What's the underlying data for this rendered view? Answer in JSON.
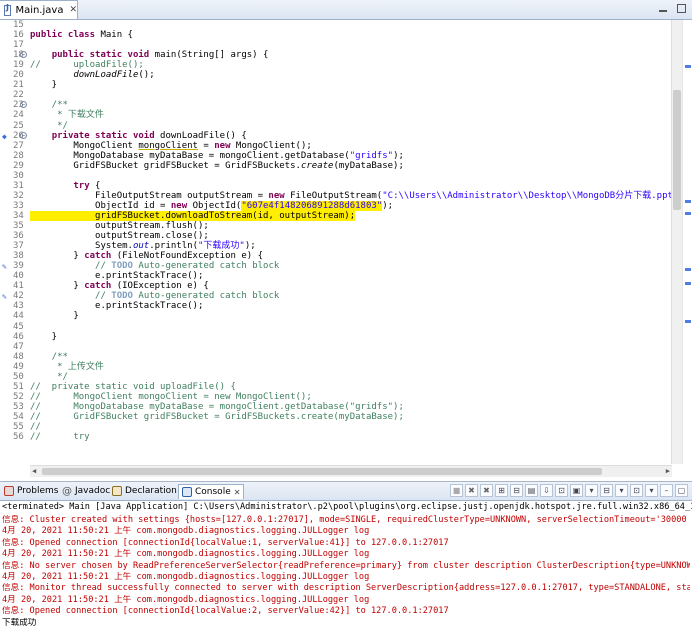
{
  "editor": {
    "tab_title": "Main.java",
    "tab_close": "✕"
  },
  "code_lines": [
    {
      "num": "15",
      "fold": "",
      "marker": "",
      "segs": [
        {
          "t": "",
          "c": ""
        }
      ]
    },
    {
      "num": "16",
      "fold": "",
      "marker": "",
      "segs": [
        {
          "t": "public class",
          "c": "kw"
        },
        {
          "t": " Main {",
          "c": ""
        }
      ]
    },
    {
      "num": "17",
      "fold": "",
      "marker": "",
      "segs": [
        {
          "t": "",
          "c": ""
        }
      ]
    },
    {
      "num": "18",
      "fold": "⊖",
      "marker": "",
      "segs": [
        {
          "t": "    ",
          "c": ""
        },
        {
          "t": "public static void",
          "c": "kw"
        },
        {
          "t": " main(String[] args) {",
          "c": ""
        }
      ]
    },
    {
      "num": "19",
      "fold": "",
      "marker": "",
      "segs": [
        {
          "t": "//      uploadFile();",
          "c": "cm"
        }
      ]
    },
    {
      "num": "20",
      "fold": "",
      "marker": "",
      "segs": [
        {
          "t": "        ",
          "c": ""
        },
        {
          "t": "downLoadFile",
          "c": "it"
        },
        {
          "t": "();",
          "c": ""
        }
      ]
    },
    {
      "num": "21",
      "fold": "",
      "marker": "",
      "segs": [
        {
          "t": "    }",
          "c": ""
        }
      ]
    },
    {
      "num": "22",
      "fold": "",
      "marker": "",
      "segs": [
        {
          "t": "",
          "c": ""
        }
      ]
    },
    {
      "num": "23",
      "fold": "⊖",
      "marker": "",
      "segs": [
        {
          "t": "    /**",
          "c": "cm"
        }
      ]
    },
    {
      "num": "24",
      "fold": "",
      "marker": "",
      "segs": [
        {
          "t": "     * 下载文件",
          "c": "cm"
        }
      ]
    },
    {
      "num": "25",
      "fold": "",
      "marker": "",
      "segs": [
        {
          "t": "     */",
          "c": "cm"
        }
      ]
    },
    {
      "num": "26",
      "fold": "⊖",
      "marker": "◆",
      "segs": [
        {
          "t": "    ",
          "c": ""
        },
        {
          "t": "private static void",
          "c": "kw"
        },
        {
          "t": " downLoadFile() {",
          "c": ""
        }
      ]
    },
    {
      "num": "27",
      "fold": "",
      "marker": "",
      "segs": [
        {
          "t": "        MongoClient ",
          "c": ""
        },
        {
          "t": "mongoClient",
          "c": "ul"
        },
        {
          "t": " = ",
          "c": ""
        },
        {
          "t": "new",
          "c": "kw"
        },
        {
          "t": " MongoClient();",
          "c": ""
        }
      ]
    },
    {
      "num": "28",
      "fold": "",
      "marker": "",
      "segs": [
        {
          "t": "        MongoDatabase myDataBase = mongoClient.getDatabase(",
          "c": ""
        },
        {
          "t": "\"gridfs\"",
          "c": "str"
        },
        {
          "t": ");",
          "c": ""
        }
      ]
    },
    {
      "num": "29",
      "fold": "",
      "marker": "",
      "segs": [
        {
          "t": "        GridFSBucket gridFSBucket = GridFSBuckets.",
          "c": ""
        },
        {
          "t": "create",
          "c": "it"
        },
        {
          "t": "(myDataBase);",
          "c": ""
        }
      ]
    },
    {
      "num": "30",
      "fold": "",
      "marker": "",
      "segs": [
        {
          "t": "",
          "c": ""
        }
      ]
    },
    {
      "num": "31",
      "fold": "",
      "marker": "",
      "segs": [
        {
          "t": "        ",
          "c": ""
        },
        {
          "t": "try",
          "c": "kw"
        },
        {
          "t": " {",
          "c": ""
        }
      ]
    },
    {
      "num": "32",
      "fold": "",
      "marker": "",
      "segs": [
        {
          "t": "            FileOutputStream outputStream = ",
          "c": ""
        },
        {
          "t": "new",
          "c": "kw"
        },
        {
          "t": " FileOutputStream(",
          "c": ""
        },
        {
          "t": "\"C:\\\\Users\\\\Administrator\\\\Desktop\\\\MongoDB分片下载.pptx\"",
          "c": "str"
        },
        {
          "t": ");",
          "c": ""
        }
      ]
    },
    {
      "num": "33",
      "fold": "",
      "marker": "",
      "segs": [
        {
          "t": "            ObjectId id = ",
          "c": ""
        },
        {
          "t": "new",
          "c": "kw"
        },
        {
          "t": " ObjectId(",
          "c": ""
        },
        {
          "t": "\"607e4f148206891288d61803\"",
          "c": "str hl"
        },
        {
          "t": ");",
          "c": ""
        }
      ]
    },
    {
      "num": "34",
      "fold": "",
      "marker": "",
      "segs": [
        {
          "t": "            gridFSBucket.downloadToStream(id, outputStream);",
          "c": "hl"
        }
      ]
    },
    {
      "num": "35",
      "fold": "",
      "marker": "",
      "segs": [
        {
          "t": "            outputStream.flush();",
          "c": ""
        }
      ]
    },
    {
      "num": "36",
      "fold": "",
      "marker": "",
      "segs": [
        {
          "t": "            outputStream.close();",
          "c": ""
        }
      ]
    },
    {
      "num": "37",
      "fold": "",
      "marker": "",
      "segs": [
        {
          "t": "            System.",
          "c": ""
        },
        {
          "t": "out",
          "c": "fld it"
        },
        {
          "t": ".println(",
          "c": ""
        },
        {
          "t": "\"下载成功\"",
          "c": "str"
        },
        {
          "t": ");",
          "c": ""
        }
      ]
    },
    {
      "num": "38",
      "fold": "",
      "marker": "",
      "segs": [
        {
          "t": "        } ",
          "c": ""
        },
        {
          "t": "catch",
          "c": "kw"
        },
        {
          "t": " (FileNotFoundException e) {",
          "c": ""
        }
      ]
    },
    {
      "num": "39",
      "fold": "",
      "marker": "✎",
      "segs": [
        {
          "t": "            ",
          "c": ""
        },
        {
          "t": "// ",
          "c": "cm"
        },
        {
          "t": "TODO",
          "c": "task"
        },
        {
          "t": " Auto-generated catch block",
          "c": "cm"
        }
      ]
    },
    {
      "num": "40",
      "fold": "",
      "marker": "",
      "segs": [
        {
          "t": "            e.printStackTrace();",
          "c": ""
        }
      ]
    },
    {
      "num": "41",
      "fold": "",
      "marker": "",
      "segs": [
        {
          "t": "        } ",
          "c": ""
        },
        {
          "t": "catch",
          "c": "kw"
        },
        {
          "t": " (IOException e) {",
          "c": ""
        }
      ]
    },
    {
      "num": "42",
      "fold": "",
      "marker": "✎",
      "segs": [
        {
          "t": "            ",
          "c": ""
        },
        {
          "t": "// ",
          "c": "cm"
        },
        {
          "t": "TODO",
          "c": "task"
        },
        {
          "t": " Auto-generated catch block",
          "c": "cm"
        }
      ]
    },
    {
      "num": "43",
      "fold": "",
      "marker": "",
      "segs": [
        {
          "t": "            e.printStackTrace();",
          "c": ""
        }
      ]
    },
    {
      "num": "44",
      "fold": "",
      "marker": "",
      "segs": [
        {
          "t": "        }",
          "c": ""
        }
      ]
    },
    {
      "num": "45",
      "fold": "",
      "marker": "",
      "segs": [
        {
          "t": "",
          "c": ""
        }
      ]
    },
    {
      "num": "46",
      "fold": "",
      "marker": "",
      "segs": [
        {
          "t": "    }",
          "c": ""
        }
      ]
    },
    {
      "num": "47",
      "fold": "",
      "marker": "",
      "segs": [
        {
          "t": "",
          "c": ""
        }
      ]
    },
    {
      "num": "48",
      "fold": "",
      "marker": "",
      "segs": [
        {
          "t": "    /**",
          "c": "cm"
        }
      ]
    },
    {
      "num": "49",
      "fold": "",
      "marker": "",
      "segs": [
        {
          "t": "     * 上传文件",
          "c": "cm"
        }
      ]
    },
    {
      "num": "50",
      "fold": "",
      "marker": "",
      "segs": [
        {
          "t": "     */",
          "c": "cm"
        }
      ]
    },
    {
      "num": "51",
      "fold": "",
      "marker": "",
      "segs": [
        {
          "t": "//  private static void uploadFile() {",
          "c": "cm"
        }
      ]
    },
    {
      "num": "52",
      "fold": "",
      "marker": "",
      "segs": [
        {
          "t": "//      MongoClient mongoClient = new MongoClient();",
          "c": "cm"
        }
      ]
    },
    {
      "num": "53",
      "fold": "",
      "marker": "",
      "segs": [
        {
          "t": "//      MongoDatabase myDataBase = mongoClient.getDatabase(\"gridfs\");",
          "c": "cm"
        }
      ]
    },
    {
      "num": "54",
      "fold": "",
      "marker": "",
      "segs": [
        {
          "t": "//      GridFSBucket gridFSBucket = GridFSBuckets.create(myDataBase);",
          "c": "cm"
        }
      ]
    },
    {
      "num": "55",
      "fold": "",
      "marker": "",
      "segs": [
        {
          "t": "//",
          "c": "cm"
        }
      ]
    },
    {
      "num": "56",
      "fold": "",
      "marker": "",
      "segs": [
        {
          "t": "//      try",
          "c": "cm"
        }
      ]
    }
  ],
  "console": {
    "tabs": [
      {
        "label": "Problems",
        "icon": "problems-icon",
        "color": "#c0392b"
      },
      {
        "label": "Javadoc",
        "icon": "javadoc-icon",
        "color": "#555555"
      },
      {
        "label": "Declaration",
        "icon": "declaration-icon",
        "color": "#8a6d1d"
      },
      {
        "label": "Console",
        "icon": "console-icon",
        "color": "#2f5fa8"
      }
    ],
    "console_close": "✕",
    "terminated": "<terminated> Main [Java Application] C:\\Users\\Administrator\\.p2\\pool\\plugins\\org.eclipse.justj.openjdk.hotspot.jre.full.win32.x86_64_15.0.2.v20210201-0955\\jre\\",
    "lines": [
      {
        "text": "信息: Cluster created with settings {hosts=[127.0.0.1:27017], mode=SINGLE, requiredClusterType=UNKNOWN, serverSelectionTimeout='30000 ms'",
        "black": false
      },
      {
        "text": "4月 20, 2021 11:50:21 上午 com.mongodb.diagnostics.logging.JULLogger log",
        "black": false
      },
      {
        "text": "信息: Opened connection [connectionId{localValue:1, serverValue:41}] to 127.0.0.1:27017",
        "black": false
      },
      {
        "text": "4月 20, 2021 11:50:21 上午 com.mongodb.diagnostics.logging.JULLogger log",
        "black": false
      },
      {
        "text": "信息: No server chosen by ReadPreferenceServerSelector{readPreference=primary} from cluster description ClusterDescription{type=UNKNOWN,",
        "black": false
      },
      {
        "text": "4月 20, 2021 11:50:21 上午 com.mongodb.diagnostics.logging.JULLogger log",
        "black": false
      },
      {
        "text": "信息: Monitor thread successfully connected to server with description ServerDescription{address=127.0.0.1:27017, type=STANDALONE, state",
        "black": false
      },
      {
        "text": "4月 20, 2021 11:50:21 上午 com.mongodb.diagnostics.logging.JULLogger log",
        "black": false
      },
      {
        "text": "信息: Opened connection [connectionId{localValue:2, serverValue:42}] to 127.0.0.1:27017",
        "black": false
      },
      {
        "text": "下载成功",
        "black": true
      }
    ],
    "toolbar": [
      "■",
      "✖",
      "✖",
      "⊞",
      "⊟",
      "▤",
      "⇩",
      "⊡",
      "▣",
      "▾",
      "⊟",
      "▾",
      "⊡",
      "▾",
      "–",
      "▢"
    ]
  }
}
